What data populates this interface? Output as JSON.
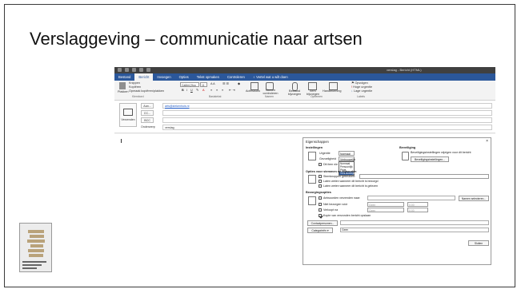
{
  "slide": {
    "title": "Verslaggeving – communicatie naar artsen"
  },
  "window": {
    "title": "verslag - Bericht (HTML)"
  },
  "menu": {
    "items": [
      "Bestand",
      "Bericht",
      "Invoegen",
      "Opties",
      "Tekst opmaken",
      "Controleren",
      "Vertel wat u wilt doen"
    ],
    "active": "Bericht"
  },
  "ribbon": {
    "paste": "Plakken",
    "cut": "Knippen",
    "copy": "Kopiëren",
    "format_painter": "Opmaak kopiëren/plakken",
    "group_clipboard": "Klembord",
    "font_name": "Calibri (Hoo",
    "font_size": "11",
    "group_basic_text": "Basistekst",
    "address_book": "Adresboek",
    "check_names": "Namen controleren",
    "group_names": "Namen",
    "attach_file": "Bestand bijvoegen",
    "attach_item": "Item bijvoegen",
    "signature": "Handtekening",
    "group_include": "Opnemen",
    "follow_up": "Opvolgen",
    "high_importance": "Hoge urgentie",
    "low_importance": "Lage urgentie",
    "group_tags": "Labels"
  },
  "compose": {
    "send": "Verzenden",
    "to_button": "Aan...",
    "to_value": "arts@ziekenhuis.nl",
    "cc_button": "CC...",
    "bcc_button": "BCC",
    "subject_label": "Onderwerp",
    "subject_value": "verslag"
  },
  "dialog": {
    "title": "Eigenschappen",
    "close": "×",
    "settings_header": "Instellingen",
    "security_header": "Beveiliging",
    "importance_label": "Urgentie",
    "importance_value": "Normaal",
    "sensitivity_label": "Gevoeligheid",
    "sensitivity_value": "Vertrouwelijk",
    "sensitivity_options": [
      "Normaal",
      "Persoonlijk",
      "Privé",
      "Vertrouwelijk"
    ],
    "sensitivity_selected_index": 3,
    "do_not_autoarchive": "Dit item niet automatisch archiveren",
    "security_text": "Beveiligingsinstellingen wijzigen voor dit bericht",
    "security_button": "Beveiligingsinstellingen...",
    "voting_header": "Opties voor stemmen en bijhouden",
    "use_voting": "Stemknoppen gebruiken:",
    "delivery_receipt": "Laten weten wanneer dit bericht is bezorgd",
    "read_receipt": "Laten weten wanneer dit bericht is gelezen",
    "delivery_header": "Bezorgingsopties",
    "replies_to": "Antwoorden verzenden naar:",
    "select_names": "Namen selecteren...",
    "do_not_deliver": "Niet bezorgen vóór",
    "expires": "Verloopt na",
    "date_none": "Geen",
    "time_value": "0:00",
    "save_copy": "Kopie van verzonden bericht opslaan",
    "contacts_button": "Contactpersonen...",
    "categories_button": "Categorieën",
    "categories_value": "Geen",
    "close_button": "Sluiten",
    "checks": {
      "do_not_autoarchive": false,
      "use_voting": false,
      "delivery_receipt": false,
      "read_receipt": false,
      "replies_to": false,
      "do_not_deliver": false,
      "expires": false,
      "save_copy": true
    }
  },
  "colors": {
    "accent": "#2b579a",
    "titlebar": "#404040"
  }
}
